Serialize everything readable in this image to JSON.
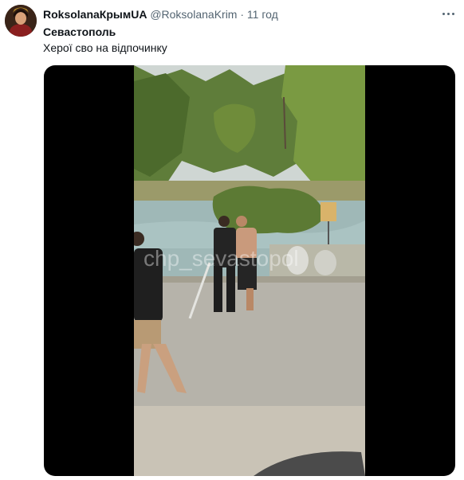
{
  "tweet": {
    "author_name": "RoksolanaКрымUA",
    "author_handle": "@RoksolanaKrim",
    "separator": "·",
    "time": "11 год",
    "text_line1": "Севастополь",
    "text_line2": "Херої сво на відпочинку",
    "media": {
      "watermark": "chp_sevastopol"
    }
  },
  "icons": {
    "more": "more-horizontal-icon"
  }
}
